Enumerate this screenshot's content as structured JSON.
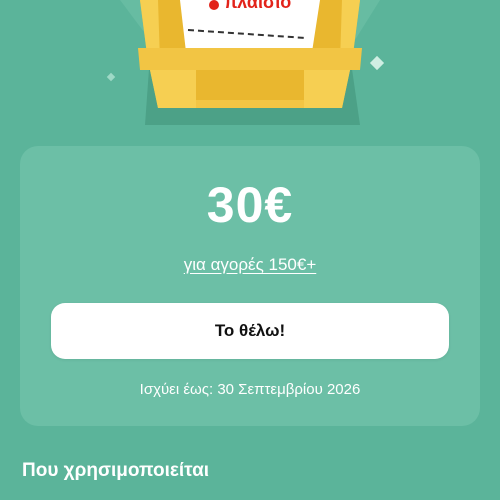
{
  "hero": {
    "logo_text": "πλαίσιο",
    "icon": "coupon-basket-illustration"
  },
  "coupon": {
    "amount": "30€",
    "condition": "για αγορές 150€+",
    "cta_label": "Το θέλω!",
    "validity": "Ισχύει έως: 30 Σεπτεμβρίου 2026"
  },
  "usage": {
    "title": "Που χρησιμοποιείται"
  },
  "colors": {
    "background": "#5bb49a",
    "card": "#6cbfa6",
    "basket": "#f2c544",
    "brand_red": "#e2231a"
  }
}
